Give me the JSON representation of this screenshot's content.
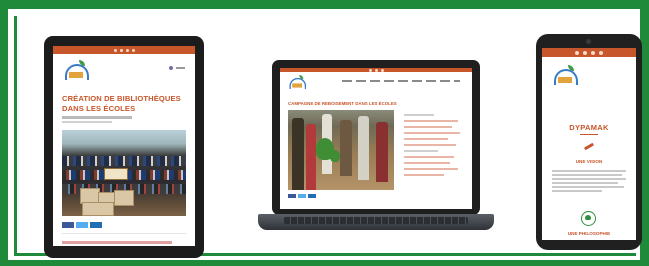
{
  "colors": {
    "frame_green": "#1e8a3a",
    "brand_orange": "#c8562b",
    "device_body": "#1c1c1c"
  },
  "tablet": {
    "article_title": "CRÉATION DE BIBLIOTHÈQUES DANS LES ÉCOLES",
    "share_icons": [
      "facebook-icon",
      "twitter-icon",
      "linkedin-icon"
    ]
  },
  "laptop": {
    "article_title": "CAMPAGNE DE REBOISEMENT DANS LES ÉCOLES",
    "share_icons": [
      "facebook-icon",
      "twitter-icon",
      "linkedin-icon"
    ]
  },
  "phone": {
    "brand_title": "DYPAMAK",
    "section_vision": "UNE VISION",
    "section_philosophy": "UNE PHILOSOPHIE"
  }
}
